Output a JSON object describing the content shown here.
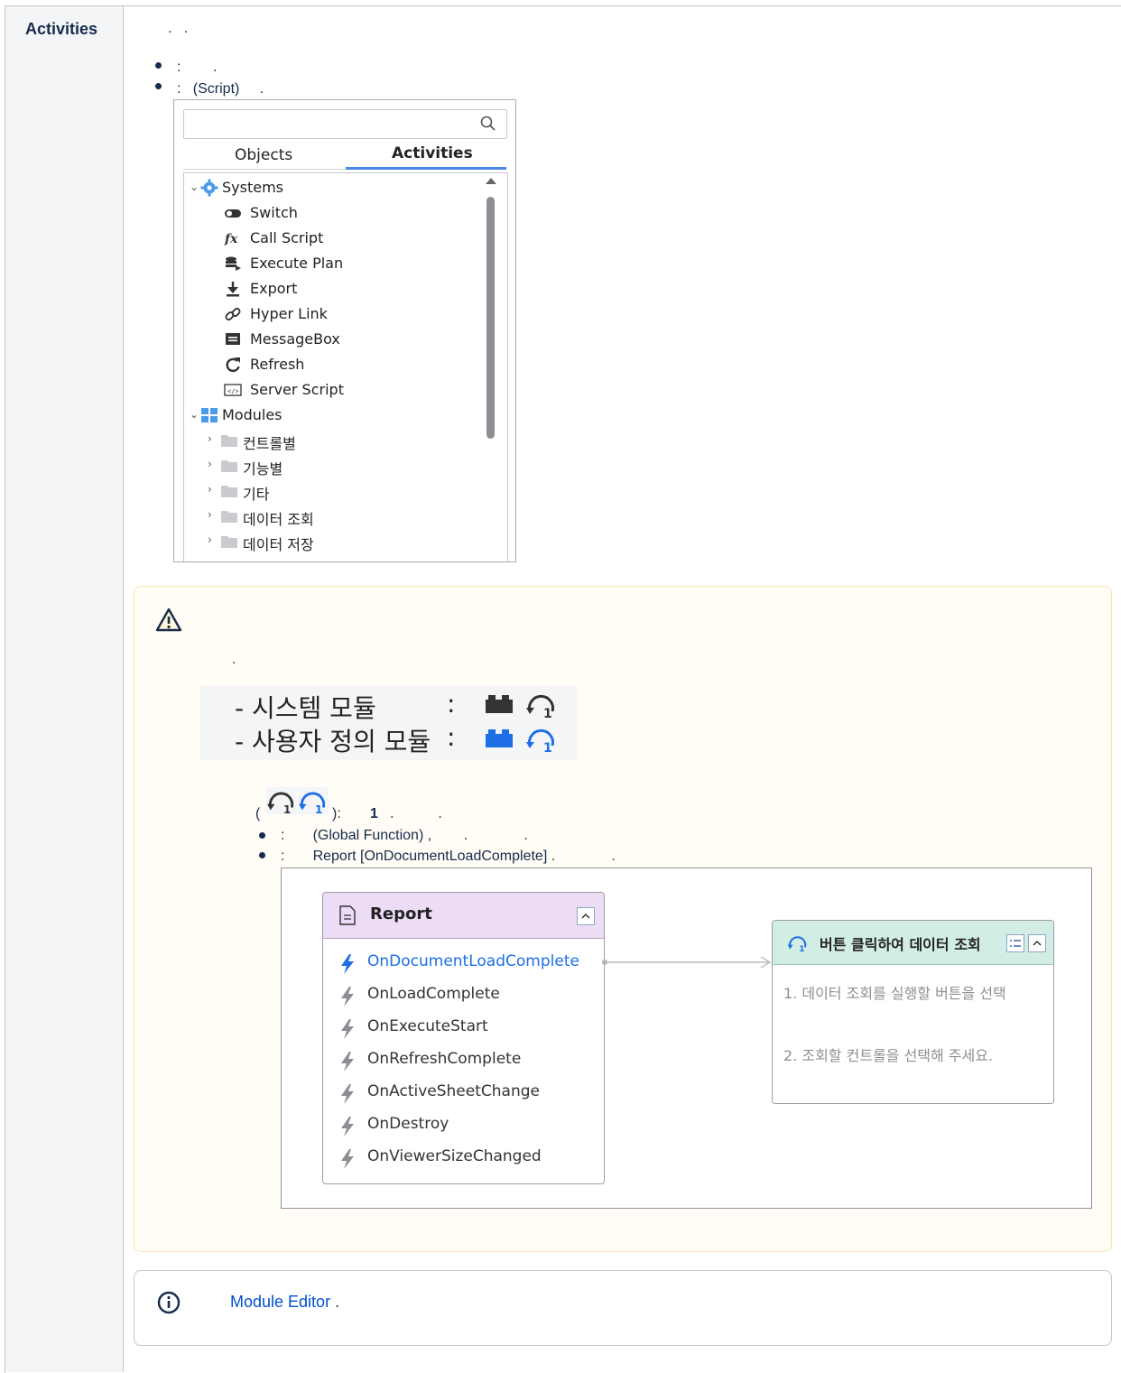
{
  "table": {
    "header": "Activities",
    "intro": ".   .",
    "bullets": [
      ":        .",
      ":   (Script)     ."
    ]
  },
  "panel": {
    "tabs": [
      "Objects",
      "Activities"
    ],
    "active_tab": "Activities",
    "search_placeholder": "",
    "systems_group": "Systems",
    "systems": [
      {
        "label": "Switch",
        "icon": "toggle-icon"
      },
      {
        "label": "Call Script",
        "icon": "fx-icon"
      },
      {
        "label": "Execute Plan",
        "icon": "database-run-icon"
      },
      {
        "label": "Export",
        "icon": "download-icon"
      },
      {
        "label": "Hyper Link",
        "icon": "link-icon"
      },
      {
        "label": "MessageBox",
        "icon": "message-icon"
      },
      {
        "label": "Refresh",
        "icon": "refresh-icon"
      },
      {
        "label": "Server Script",
        "icon": "code-icon"
      }
    ],
    "modules_group": "Modules",
    "modules": [
      "컨트롤별",
      "기능별",
      "기타",
      "데이터 조회",
      "데이터 저장"
    ]
  },
  "warning": {
    "text": ".",
    "legend": [
      {
        "label": "- 시스템 모듈",
        "sep": ":",
        "color": "#333333"
      },
      {
        "label": "- 사용자 정의 모듈",
        "sep": ":",
        "color": "#1e6ee6"
      }
    ],
    "line1_pre": "(",
    "line1_post": "):",
    "line1_bold": "1",
    "line1_end": ".           .",
    "bullets": [
      ":       (Global Function) ,        .              .",
      ":       Report [OnDocumentLoadComplete] .              ."
    ],
    "diagram": {
      "report_title": "Report",
      "events": [
        "OnDocumentLoadComplete",
        "OnLoadComplete",
        "OnExecuteStart",
        "OnRefreshComplete",
        "OnActiveSheetChange",
        "OnDestroy",
        "OnViewerSizeChanged"
      ],
      "active_event": "OnDocumentLoadComplete",
      "module_title": "버튼 클릭하여 데이터 조회",
      "module_steps": [
        "1. 데이터 조회를 실행할 버튼을 선택",
        "2. 조회할 컨트롤을 선택해 주세요."
      ]
    }
  },
  "info": {
    "link_text": "Module Editor",
    "after": " ."
  },
  "colors": {
    "accent_blue": "#4a86e8",
    "link": "#0052cc",
    "active_event": "#1e6ee6"
  }
}
